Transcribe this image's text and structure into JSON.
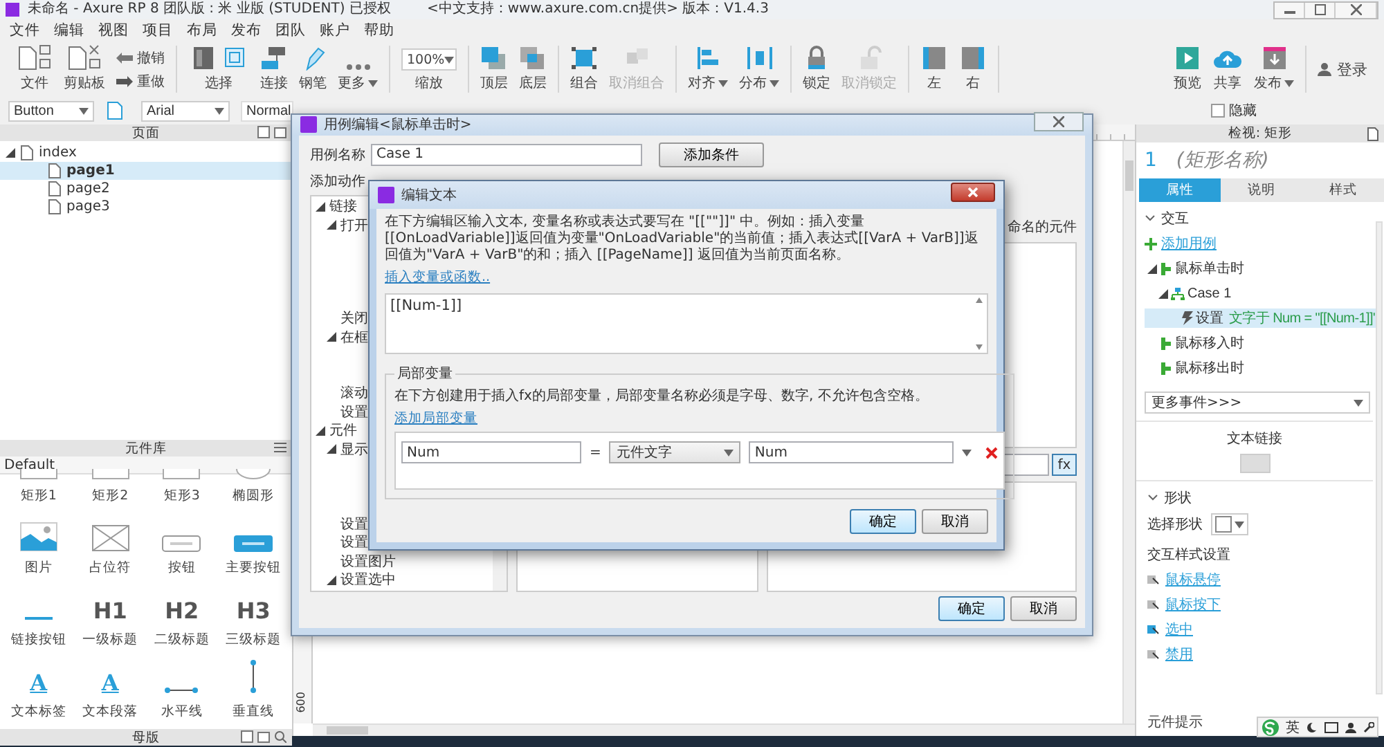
{
  "title_bar": {
    "title": "未命名 - Axure RP 8 团队版 : 米 业版 (STUDENT) 已授权",
    "support": "<中文支持：www.axure.com.cn提供> 版本：V1.4.3"
  },
  "menu": [
    "文件",
    "编辑",
    "视图",
    "项目",
    "布局",
    "发布",
    "团队",
    "账户",
    "帮助"
  ],
  "toolbar": {
    "left": [
      [
        {
          "kind": "file",
          "label": "文件",
          "disabled": false
        },
        {
          "kind": "clipboard",
          "label": "剪贴板",
          "disabled": false
        },
        {
          "kind": "undo",
          "label": "撤销",
          "disabled": false
        },
        {
          "kind": "redo",
          "label": "重做",
          "disabled": false
        }
      ],
      [
        {
          "kind": "select",
          "label": "选择",
          "disabled": false
        },
        {
          "kind": "connect",
          "label": "连接",
          "disabled": false
        },
        {
          "kind": "pen",
          "label": "钢笔",
          "disabled": false
        },
        {
          "kind": "more",
          "label": "更多",
          "caret": true,
          "disabled": false
        }
      ],
      [
        {
          "kind": "zoom",
          "value": "100%",
          "label": "缩放",
          "disabled": false
        }
      ],
      [
        {
          "kind": "top",
          "label": "顶层",
          "disabled": false
        },
        {
          "kind": "bottom",
          "label": "底层",
          "disabled": false
        }
      ],
      [
        {
          "kind": "group",
          "label": "组合",
          "disabled": false
        },
        {
          "kind": "ungroup",
          "label": "取消组合",
          "disabled": true
        }
      ],
      [
        {
          "kind": "align",
          "label": "对齐",
          "caret": true,
          "disabled": false
        },
        {
          "kind": "distribute",
          "label": "分布",
          "caret": true,
          "disabled": false
        }
      ],
      [
        {
          "kind": "lock",
          "label": "锁定",
          "disabled": false
        },
        {
          "kind": "unlock",
          "label": "取消锁定",
          "disabled": true
        }
      ],
      [
        {
          "kind": "left",
          "label": "左",
          "disabled": false
        },
        {
          "kind": "right",
          "label": "右",
          "disabled": false
        }
      ]
    ],
    "right": [
      [
        {
          "kind": "preview",
          "label": "预览",
          "disabled": false
        },
        {
          "kind": "share",
          "label": "共享",
          "disabled": false
        },
        {
          "kind": "publish",
          "label": "发布",
          "caret": true,
          "disabled": false
        }
      ],
      [
        {
          "kind": "login",
          "label": "登录",
          "disabled": false
        }
      ]
    ]
  },
  "format_bar": {
    "widget_type": "Button",
    "font": "Arial",
    "font_style": "Normal",
    "hidden": {
      "label": "隐藏",
      "checked": false
    }
  },
  "pages": {
    "title": "页面",
    "tree": [
      {
        "label": "index",
        "expanded": true,
        "selected": false,
        "children": [
          {
            "label": "page1",
            "selected": true
          },
          {
            "label": "page2",
            "selected": false
          },
          {
            "label": "page3",
            "selected": false
          }
        ]
      }
    ]
  },
  "library": {
    "title": "元件库",
    "selected_library": "Default",
    "widgets": [
      {
        "label": "矩形1",
        "kind": "rect"
      },
      {
        "label": "矩形2",
        "kind": "rect"
      },
      {
        "label": "矩形3",
        "kind": "rect"
      },
      {
        "label": "椭圆形",
        "kind": "ellipse"
      },
      {
        "label": "图片",
        "kind": "image"
      },
      {
        "label": "占位符",
        "kind": "placeholder"
      },
      {
        "label": "按钮",
        "kind": "button"
      },
      {
        "label": "主要按钮",
        "kind": "primary"
      },
      {
        "label": "链接按钮",
        "kind": "link"
      },
      {
        "label": "一级标题",
        "kind": "heading",
        "glyph": "H1"
      },
      {
        "label": "二级标题",
        "kind": "heading",
        "glyph": "H2"
      },
      {
        "label": "三级标题",
        "kind": "heading",
        "glyph": "H3"
      },
      {
        "label": "文本标签",
        "kind": "text",
        "glyph": "A"
      },
      {
        "label": "文本段落",
        "kind": "paragraph",
        "glyph": "A"
      },
      {
        "label": "水平线",
        "kind": "hline"
      },
      {
        "label": "垂直线",
        "kind": "vline"
      }
    ]
  },
  "masters": {
    "title": "母版"
  },
  "canvas": {
    "ruler_label": "600"
  },
  "inspector": {
    "title": "检视: 矩形",
    "number": "1",
    "name_placeholder": "(矩形名称)",
    "tabs": [
      {
        "label": "属性",
        "selected": true
      },
      {
        "label": "说明",
        "selected": false
      },
      {
        "label": "样式",
        "selected": false
      }
    ],
    "interaction": {
      "heading": "交互",
      "expanded": true,
      "add_case": "添加用例",
      "more_events": "更多事件>>>",
      "events": [
        {
          "kind": "event",
          "label": "鼠标单击时",
          "expanded": true,
          "selected": false,
          "children": [
            {
              "kind": "case",
              "label": "Case 1",
              "expanded": true,
              "selected": false,
              "children": [
                {
                  "kind": "action",
                  "label": "设置",
                  "detail": "文字于 Num = \"[[Num-1]]\"",
                  "selected": true
                }
              ]
            }
          ]
        },
        {
          "kind": "event",
          "label": "鼠标移入时",
          "selected": false
        },
        {
          "kind": "event",
          "label": "鼠标移出时",
          "selected": false
        }
      ]
    },
    "text_link": "文本链接",
    "shape": {
      "heading": "形状",
      "expanded": true,
      "select_label": "选择形状",
      "style_heading": "交互样式设置",
      "styles": [
        "鼠标悬停",
        "鼠标按下",
        "选中",
        "禁用"
      ]
    },
    "footer_label": "元件提示"
  },
  "case_dialog": {
    "title": "用例编辑<鼠标单击时>",
    "name_label": "用例名称",
    "case_name": "Case 1",
    "add_condition": "添加条件",
    "actions_label": "添加动作",
    "actions": [
      {
        "label": "链接",
        "expanded": true,
        "children": [
          {
            "label": "打开",
            "expanded": true,
            "children": [
              {
                "kind": "covered"
              },
              {
                "kind": "covered"
              },
              {
                "kind": "covered"
              },
              {
                "kind": "covered"
              }
            ]
          },
          {
            "label": "关闭"
          },
          {
            "label": "在框",
            "expanded": true,
            "children": [
              {
                "kind": "covered"
              },
              {
                "kind": "covered"
              }
            ]
          },
          {
            "label": "滚动"
          },
          {
            "label": "设置"
          }
        ]
      },
      {
        "label": "元件",
        "expanded": true,
        "children": [
          {
            "label": "显示",
            "expanded": true,
            "children": [
              {
                "kind": "covered"
              },
              {
                "kind": "covered"
              },
              {
                "kind": "covered"
              }
            ]
          },
          {
            "label": "设置"
          },
          {
            "label": "设置"
          },
          {
            "label": "设置图片"
          },
          {
            "label": "设置选中",
            "expanded": true
          }
        ]
      }
    ],
    "config_hint": "命名的元件",
    "fx": "fx",
    "ok": "确定",
    "cancel": "取消"
  },
  "text_dialog": {
    "title": "编辑文本",
    "description": "在下方编辑区输入文本, 变量名称或表达式要写在 \"[[\"\"]]\" 中。例如：插入变量[[OnLoadVariable]]返回值为变量\"OnLoadVariable\"的当前值；插入表达式[[VarA + VarB]]返回值为\"VarA + VarB\"的和；插入 [[PageName]] 返回值为当前页面名称。",
    "insert_link": "插入变量或函数..",
    "text_value": "[[Num-1]]",
    "group_title": "局部变量",
    "group_text": "在下方创建用于插入fx的局部变量，局部变量名称必须是字母、数字, 不允许包含空格。",
    "add_variable_link": "添加局部变量",
    "variables": [
      {
        "name": "Num",
        "operator": "=",
        "type": "元件文字",
        "target": "Num"
      }
    ],
    "ok": "确定",
    "cancel": "取消"
  },
  "ime": {
    "label": "英"
  }
}
